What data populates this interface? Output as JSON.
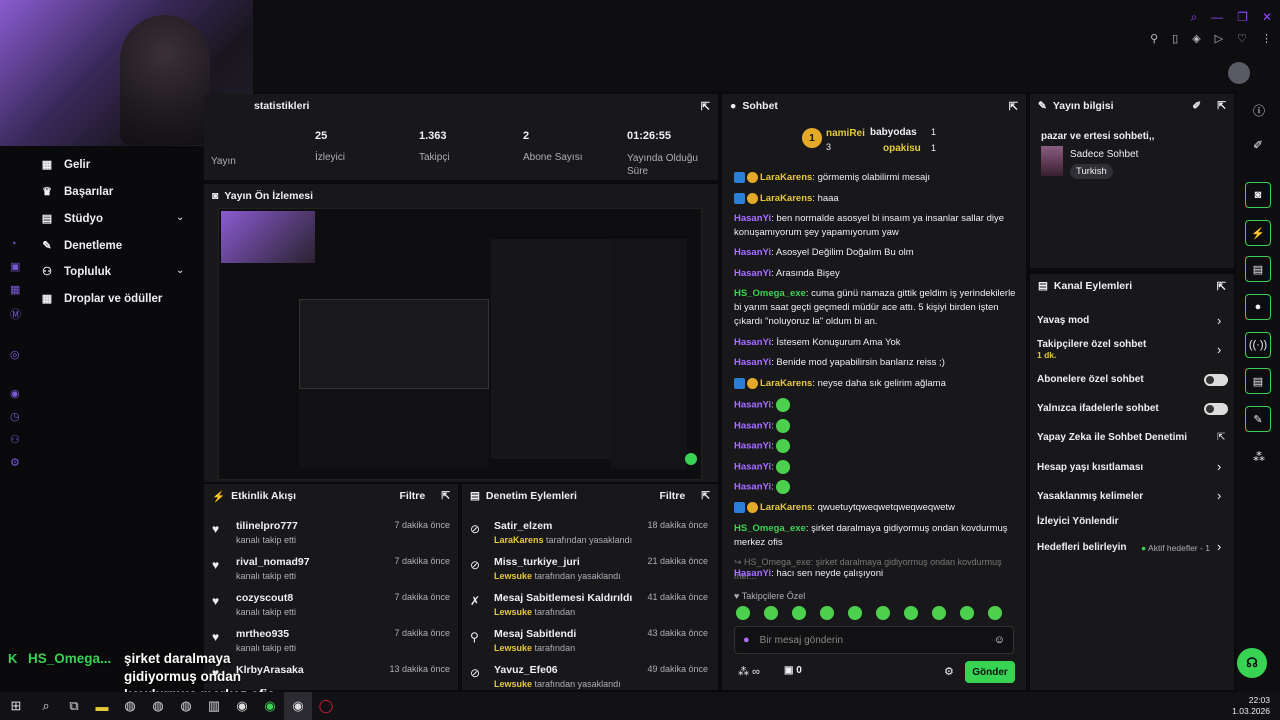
{
  "stats": {
    "title": "statistikleri",
    "items": [
      {
        "label": "Yayın",
        "value": ""
      },
      {
        "label": "İzleyici",
        "value": "25"
      },
      {
        "label": "Takipçi",
        "value": "1.363"
      },
      {
        "label": "Abone Sayısı",
        "value": "2"
      },
      {
        "label": "Yayında Olduğu Süre",
        "value": "01:26:55"
      }
    ]
  },
  "nav": {
    "items": [
      {
        "label": "Gelir"
      },
      {
        "label": "Başarılar"
      },
      {
        "label": "Stüdyo"
      },
      {
        "label": "Denetleme"
      },
      {
        "label": "Topluluk"
      },
      {
        "label": "Droplar ve ödüller"
      }
    ]
  },
  "preview": {
    "title": "Yayın Ön İzlemesi"
  },
  "activity": {
    "title": "Etkinlik Akışı",
    "filter": "Filtre",
    "items": [
      {
        "name": "tilinelpro777",
        "sub": "kanalı takip etti",
        "time": "7 dakika önce"
      },
      {
        "name": "rival_nomad97",
        "sub": "kanalı takip etti",
        "time": "7 dakika önce"
      },
      {
        "name": "cozyscout8",
        "sub": "kanalı takip etti",
        "time": "7 dakika önce"
      },
      {
        "name": "mrtheo935",
        "sub": "kanalı takip etti",
        "time": "7 dakika önce"
      },
      {
        "name": "KlrbyArasaka",
        "sub": "",
        "time": "13 dakika önce"
      }
    ]
  },
  "moderation": {
    "title": "Denetim Eylemleri",
    "filter": "Filtre",
    "items": [
      {
        "name": "Satir_elzem",
        "by": "LaraKarens",
        "sub": "tarafından yasaklandı",
        "time": "18 dakika önce"
      },
      {
        "name": "Miss_turkiye_juri",
        "by": "Lewsuke",
        "sub": "tarafından yasaklandı",
        "time": "21 dakika önce"
      },
      {
        "name": "Mesaj Sabitlemesi Kaldırıldı",
        "by": "Lewsuke",
        "sub": "tarafından",
        "time": "41 dakika önce"
      },
      {
        "name": "Mesaj Sabitlendi",
        "by": "Lewsuke",
        "sub": "tarafından",
        "time": "43 dakika önce"
      },
      {
        "name": "Yavuz_Efe06",
        "by": "Lewsuke",
        "sub": "tarafından yasaklandı",
        "time": "49 dakika önce"
      }
    ]
  },
  "chat": {
    "title": "Sohbet",
    "leaders": {
      "first": "namiRei",
      "first_count": "3",
      "second": "babyodas",
      "second_count": "1",
      "third": "opakisu",
      "third_count": "1"
    },
    "messages": [
      {
        "user": "LaraKarens",
        "text": "görmemiş olabilirmi mesajı"
      },
      {
        "user": "LaraKarens",
        "text": "haaa"
      },
      {
        "user": "HasanYi",
        "text": "ben normalde asosyel bi insaım ya insanlar sallar diye konuşamıyorum şey yapamıyorum yaw"
      },
      {
        "user": "HasanYi",
        "text": "Asosyel Değilim Doğalım Bu olm"
      },
      {
        "user": "HasanYi",
        "text": "Arasında Bişey"
      },
      {
        "user": "HS_Omega_exe",
        "text": "cuma günü namaza gittik geldim iş yerindekilerle bi yarım saat geçti geçmedi müdür ace attı. 5 kişiyi birden işten çıkardı \"noluyoruz la\" oldum bi an."
      },
      {
        "user": "HasanYi",
        "text": "İstesem Konuşurum Ama Yok"
      },
      {
        "user": "HasanYi",
        "text": "Benide mod yapabilirsin banlarız reiss ;)"
      },
      {
        "user": "LaraKarens",
        "text": "neyse daha sık gelirim ağlama"
      },
      {
        "user": "LaraKarens",
        "text": "qwuetuytqweqwetqweqweqwetw"
      },
      {
        "user": "HS_Omega_exe",
        "text": "şirket daralmaya gidiyormuş ondan kovdurmuş merkez ofis"
      },
      {
        "user": "HasanYi",
        "text": "hacı sen neyde çalışıyoni"
      }
    ],
    "reply_preview": "HS_Omega_exe: şirket daralmaya gidiyormuş ondan kovdurmuş mer...",
    "followers_only": "Takipçilere Özel",
    "placeholder": "Bir mesaj gönderin",
    "points": "0",
    "send": "Gönder"
  },
  "info": {
    "title": "Yayın bilgisi",
    "stream_title": "pazar ve ertesi sohbeti,,",
    "category": "Sadece Sohbet",
    "tag": "Turkish"
  },
  "channel_actions": {
    "title": "Kanal Eylemleri",
    "items": [
      {
        "label": "Yavaş mod"
      },
      {
        "label": "Takipçilere özel sohbet",
        "sub": "1 dk."
      },
      {
        "label": "Abonelere özel sohbet"
      },
      {
        "label": "Yalnızca ifadelerle sohbet"
      },
      {
        "label": "Yapay Zeka ile Sohbet Denetimi"
      },
      {
        "label": "Hesap yaşı kısıtlaması"
      },
      {
        "label": "Yasaklanmış kelimeler"
      },
      {
        "label": "İzleyici Yönlendir"
      },
      {
        "label": "Hedefleri belirleyin",
        "sub": "Aktif hedefler - 1"
      }
    ]
  },
  "overlay": {
    "user": "HS_Omega...",
    "text": "şirket daralmaya gidiyormuş ondan kovdurmuş merkez ofis"
  },
  "taskbar": {
    "time": "22:03",
    "date": "1.03.2026"
  },
  "colors": {
    "accent": "#39d353",
    "purple": "#a970ff",
    "panel": "#18181b"
  }
}
